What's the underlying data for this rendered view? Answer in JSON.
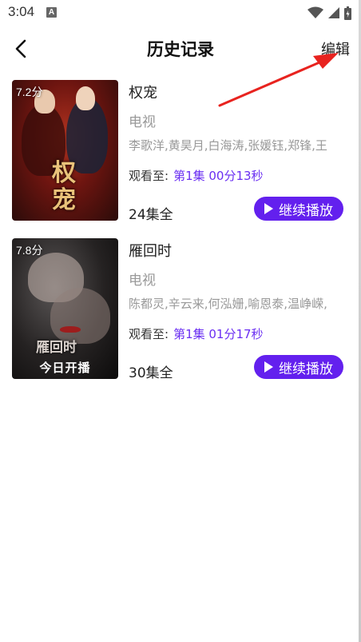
{
  "status_bar": {
    "time": "3:04",
    "notification_badge": "A"
  },
  "header": {
    "title": "历史记录",
    "edit_label": "编辑"
  },
  "items": [
    {
      "title": "权宠",
      "rating": "7.2分",
      "type": "电视",
      "cast": "李歌洋,黄昊月,白海涛,张媛钰,郑锋,王",
      "progress_prefix": "观看至:",
      "progress_episode": "第1集 00分13秒",
      "episode_count": "24集全",
      "resume_label": "继续播放",
      "poster_text": "权宠"
    },
    {
      "title": "雁回时",
      "rating": "7.8分",
      "type": "电视",
      "cast": "陈都灵,辛云来,何泓姗,喻恩泰,温峥嵘,",
      "progress_prefix": "观看至:",
      "progress_episode": "第1集 01分17秒",
      "episode_count": "30集全",
      "resume_label": "继续播放",
      "poster_text": "雁回时",
      "poster_banner": "今日开播"
    }
  ],
  "colors": {
    "accent": "#6320ee",
    "progress_text": "#6a2ef2",
    "annotation_arrow": "#e8231f"
  }
}
